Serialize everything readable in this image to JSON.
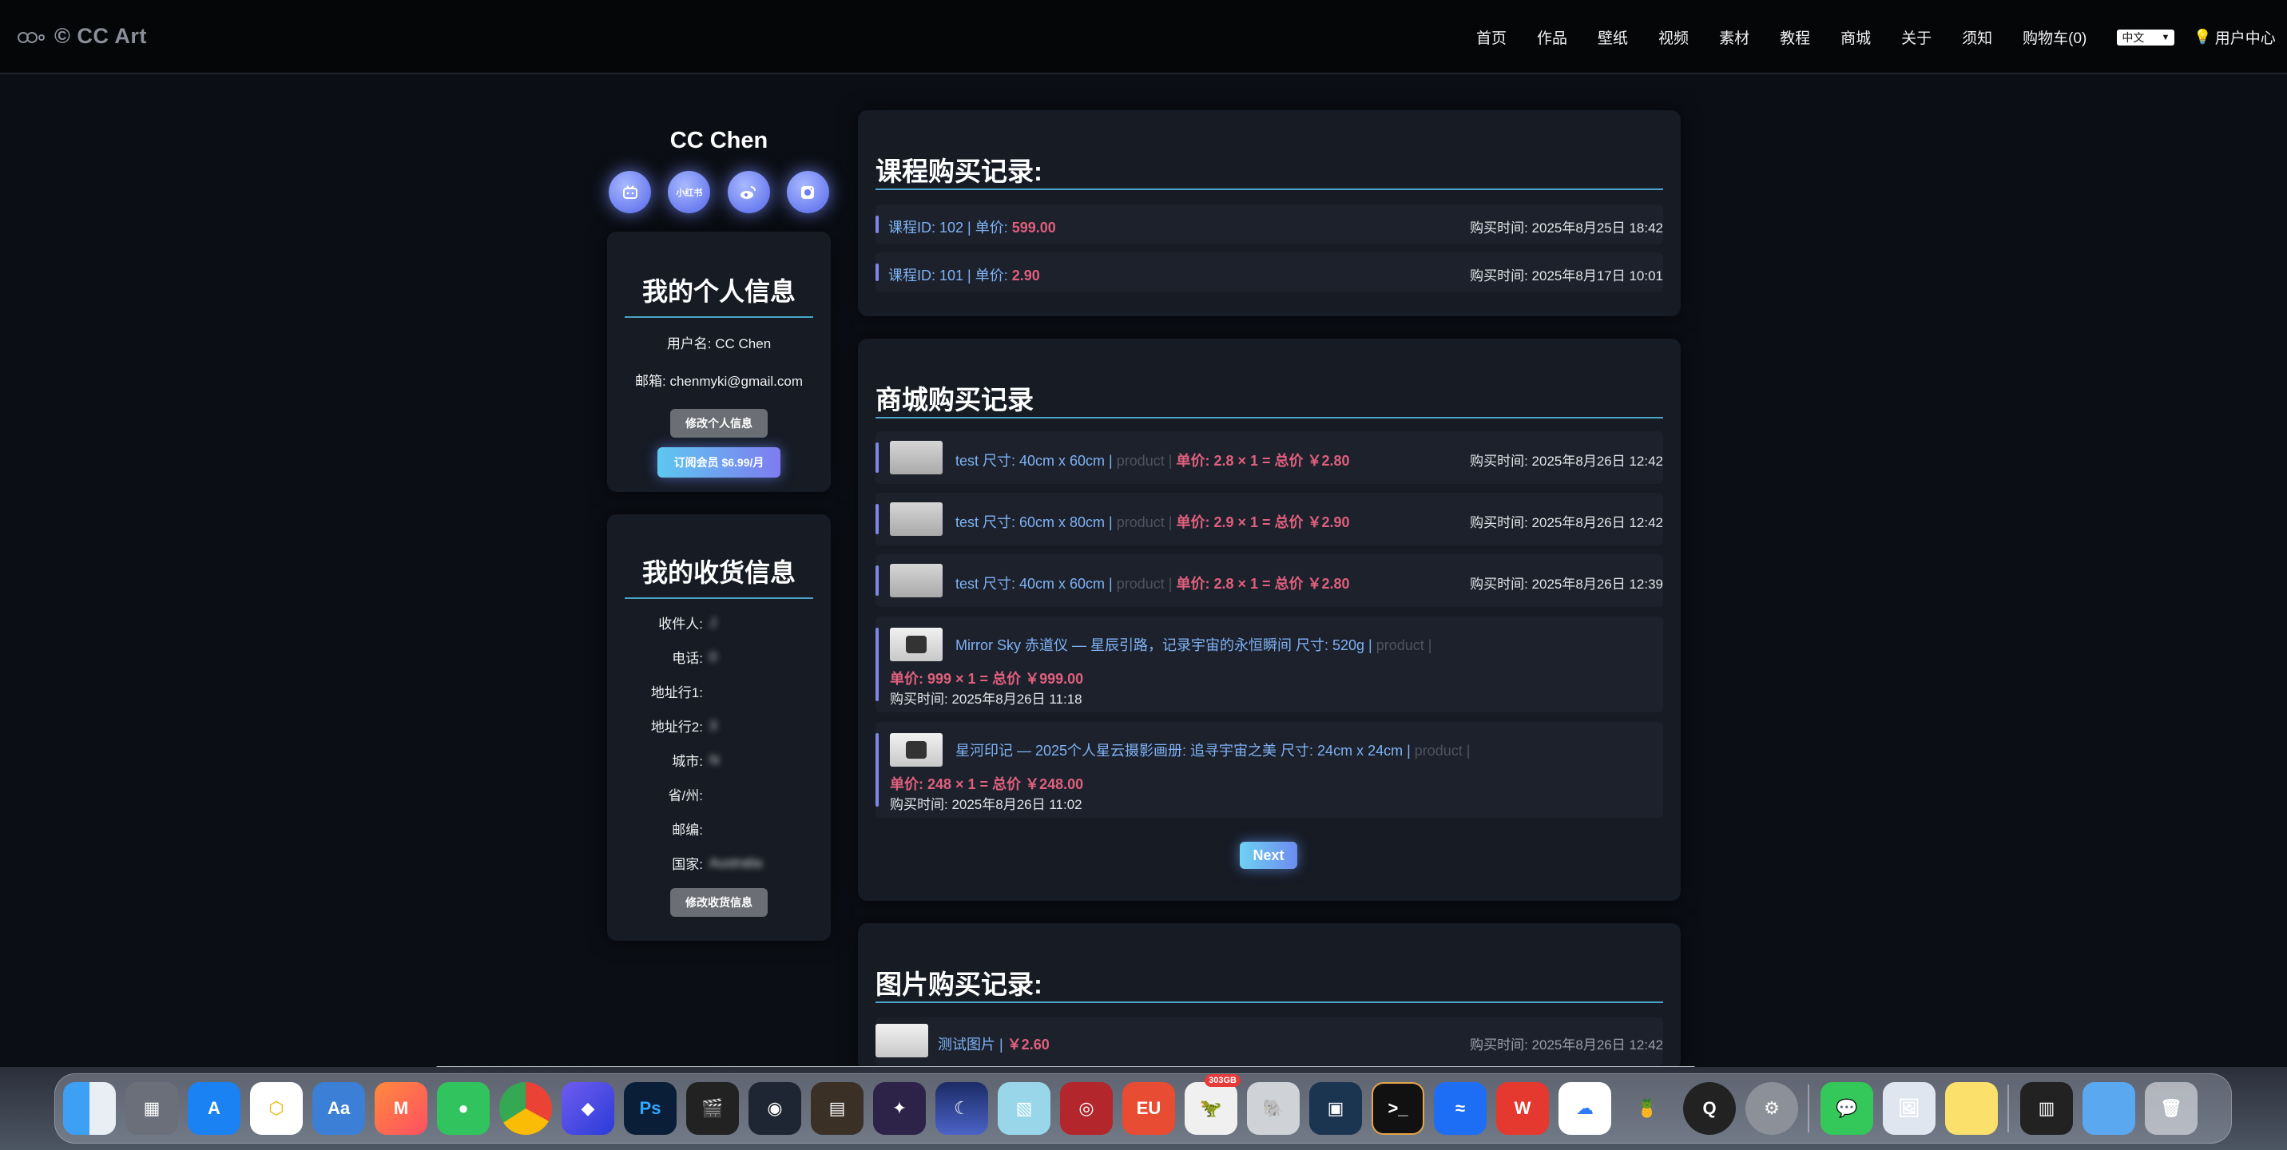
{
  "brand": {
    "name": "© CC Art"
  },
  "nav": {
    "items": [
      "首页",
      "作品",
      "壁纸",
      "视频",
      "素材",
      "教程",
      "商城",
      "关于",
      "须知",
      "购物车(0)"
    ],
    "language": "中文",
    "user_center": "用户中心"
  },
  "profile": {
    "name": "CC Chen",
    "socials": [
      "bilibili-icon",
      "小红书",
      "weibo-icon",
      "instagram-icon"
    ],
    "social_xhs_label": "小红书"
  },
  "personal_info": {
    "title": "我的个人信息",
    "username_line": "用户名:  CC Chen",
    "email_line": "邮箱: chenmyki@gmail.com",
    "edit_button": "修改个人信息",
    "subscribe_button": "订阅会员 $6.99/月"
  },
  "shipping_info": {
    "title": "我的收货信息",
    "rows": [
      {
        "label": "收件人:",
        "value": "J"
      },
      {
        "label": "电话:",
        "value": "0"
      },
      {
        "label": "地址行1:",
        "value": ""
      },
      {
        "label": "地址行2:",
        "value": "3"
      },
      {
        "label": "城市:",
        "value": "N"
      },
      {
        "label": "省/州:",
        "value": ""
      },
      {
        "label": "邮编:",
        "value": ""
      },
      {
        "label": "国家:",
        "value": "Australia"
      }
    ],
    "edit_button": "修改收货信息"
  },
  "course_records": {
    "title": "课程购买记录:",
    "items": [
      {
        "id_text": "课程ID: 102 | 单价: ",
        "price": "599.00",
        "time": "购买时间: 2025年8月25日 18:42"
      },
      {
        "id_text": "课程ID: 101 | 单价: ",
        "price": "2.90",
        "time": "购买时间: 2025年8月17日 10:01"
      }
    ]
  },
  "shop_records": {
    "title": "商城购买记录",
    "items": [
      {
        "name": "test 尺寸: 40cm x 60cm | ",
        "tag": "product | ",
        "price": "单价: 2.8 × 1 = 总价 ￥2.80",
        "time": "购买时间: 2025年8月26日 12:42"
      },
      {
        "name": "test 尺寸: 60cm x 80cm | ",
        "tag": "product | ",
        "price": "单价: 2.9 × 1 = 总价 ￥2.90",
        "time": "购买时间: 2025年8月26日 12:42"
      },
      {
        "name": "test 尺寸: 40cm x 60cm | ",
        "tag": "product | ",
        "price": "单价: 2.8 × 1 = 总价 ￥2.80",
        "time": "购买时间: 2025年8月26日 12:39"
      }
    ],
    "wide_items": [
      {
        "name": "Mirror Sky 赤道仪 — 星辰引路，记录宇宙的永恒瞬间 尺寸: 520g | ",
        "tag": "product | ",
        "price": "单价: 999 × 1 = 总价 ￥999.00",
        "time": "购买时间: 2025年8月26日 11:18"
      },
      {
        "name": "星河印记 — 2025个人星云摄影画册: 追寻宇宙之美 尺寸: 24cm x 24cm | ",
        "tag": "product | ",
        "price": "单价: 248 × 1 = 总价 ￥248.00",
        "time": "购买时间: 2025年8月26日 11:02"
      }
    ],
    "next_button": "Next"
  },
  "image_records": {
    "title": "图片购买记录:",
    "items": [
      {
        "name": "测试图片 | ",
        "price": "￥2.60",
        "time": "购买时间: 2025年8月26日 12:42"
      }
    ]
  },
  "dock": {
    "badge": "303GB",
    "eu_label": "EU",
    "ps_label": "Ps",
    "apps": [
      "finder-icon",
      "launchpad-icon",
      "app-store-icon",
      "norton-icon",
      "dictionary-icon",
      "music-creator-icon",
      "wechat-icon",
      "chrome-icon",
      "crystal-icon",
      "photoshop-icon",
      "final-cut-icon",
      "davinci-icon",
      "film-icon",
      "affinity-icon",
      "night-sky-icon",
      "ice-icon",
      "cd-icon",
      "eu-office-icon",
      "dino-icon",
      "evernote-icon",
      "window-icon",
      "terminal-icon",
      "lark-icon",
      "wps-icon",
      "baidu-cloud-icon",
      "pineapple-icon",
      "quicktime-icon",
      "settings-icon",
      "messages-icon",
      "preview-icon",
      "notes-icon",
      "pdf-icon",
      "folder-icon",
      "trash-icon"
    ]
  },
  "colors": {
    "accent_blue": "#7fb2f5",
    "price_pink": "#e0607e",
    "rule": "#4aa4c8",
    "card_bg": "#161b24"
  }
}
